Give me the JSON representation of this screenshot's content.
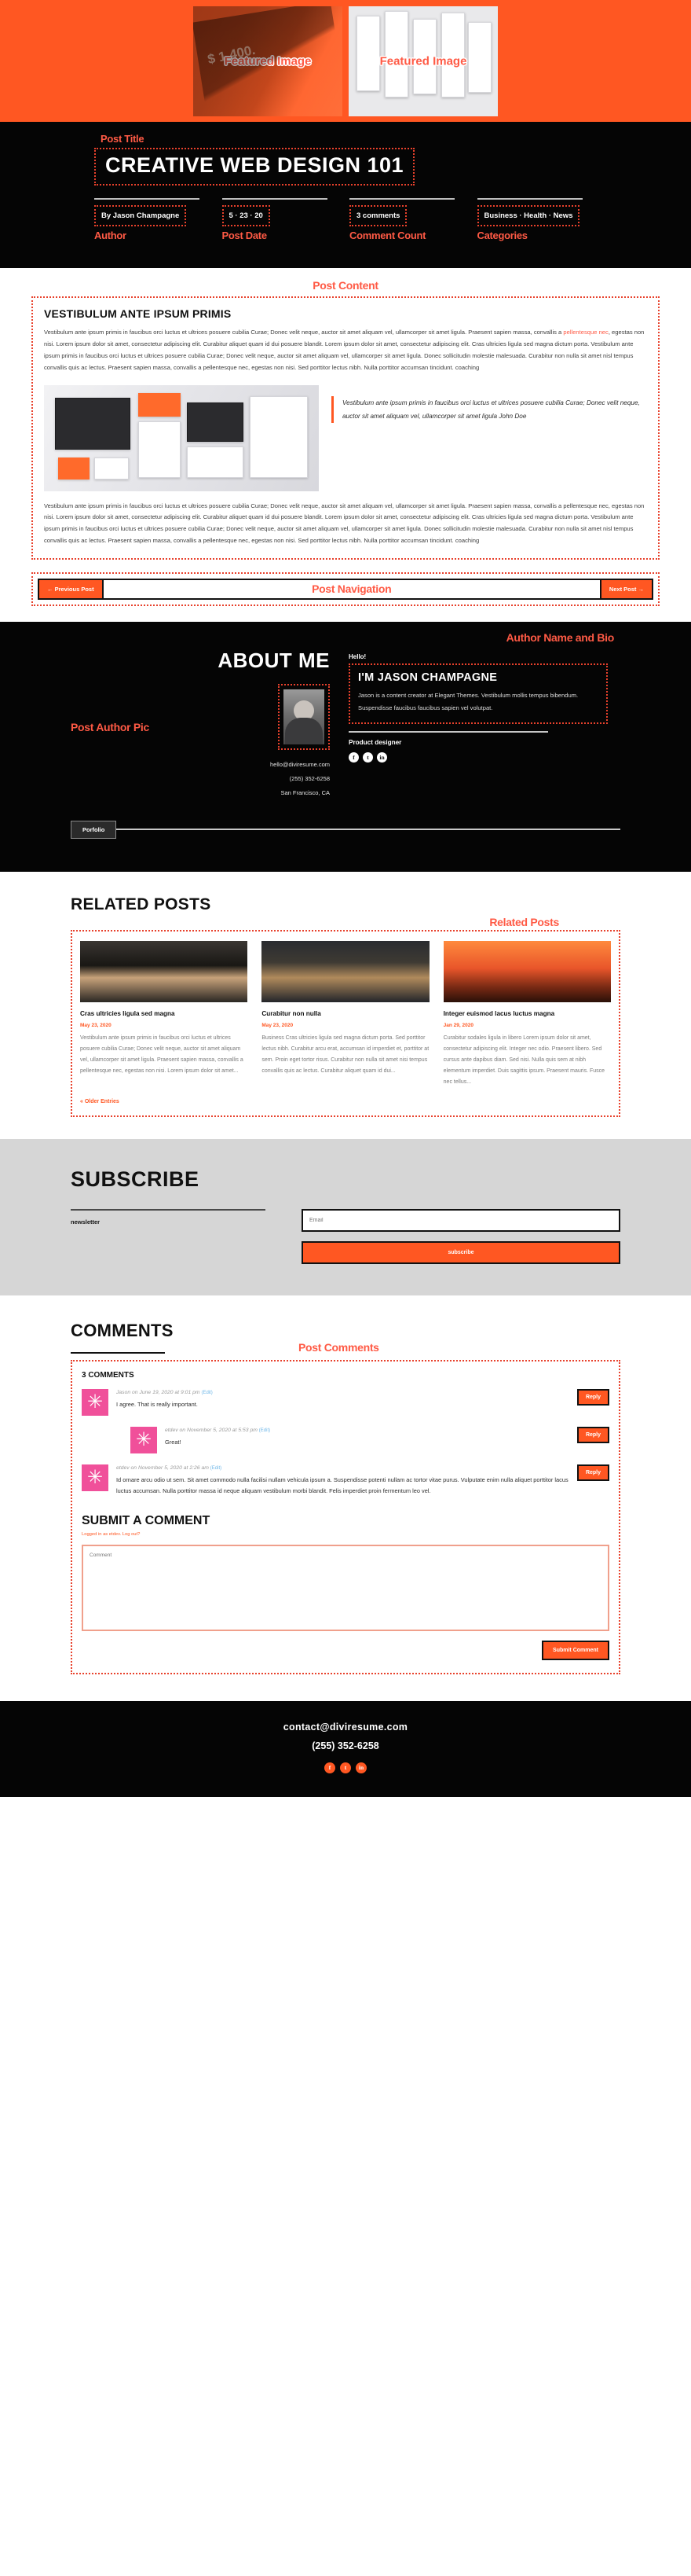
{
  "annotations": {
    "featured_image": "Featured Image",
    "post_title": "Post Title",
    "author": "Author",
    "post_date": "Post Date",
    "comment_count": "Comment Count",
    "categories": "Categories",
    "post_content": "Post Content",
    "post_navigation": "Post Navigation",
    "post_author_pic": "Post Author Pic",
    "author_name_bio": "Author Name and Bio",
    "related_posts": "Related Posts",
    "post_comments": "Post Comments"
  },
  "hero": {
    "left_price_text": "$ 1,400.",
    "label": "Featured Image"
  },
  "header": {
    "title": "CREATIVE WEB DESIGN 101",
    "meta": {
      "author": "By Jason Champagne",
      "date": "5 · 23 · 20",
      "comments": "3 comments",
      "categories": "Business · Health · News"
    }
  },
  "content": {
    "heading": "VESTIBULUM ANTE IPSUM PRIMIS",
    "paragraph1_a": "Vestibulum ante ipsum primis in faucibus orci luctus et ultrices posuere cubilia Curae; Donec velit neque, auctor sit amet aliquam vel, ullamcorper sit amet ligula. Praesent sapien massa, convallis a ",
    "paragraph1_link": "pellentesque nec",
    "paragraph1_b": ", egestas non nisi. Lorem ipsum dolor sit amet, consectetur adipiscing elit. Curabitur aliquet quam id dui posuere blandit. Lorem ipsum dolor sit amet, consectetur adipiscing elit. Cras ultricies ligula sed magna dictum porta. Vestibulum ante ipsum primis in faucibus orci luctus et ultrices posuere cubilia Curae; Donec velit neque, auctor sit amet aliquam vel, ullamcorper sit amet ligula. Donec sollicitudin molestie malesuada. Curabitur non nulla sit amet nisl tempus convallis quis ac lectus. Praesent sapien massa, convallis a pellentesque nec, egestas non nisi. Sed porttitor lectus nibh. Nulla porttitor accumsan tincidunt. coaching",
    "quote": "Vestibulum ante ipsum primis in faucibus orci luctus et ultrices posuere cubilia Curae; Donec velit neque, auctor sit amet aliquam vel, ullamcorper sit amet ligula",
    "quote_author": "John Doe",
    "paragraph2": "Vestibulum ante ipsum primis in faucibus orci luctus et ultrices posuere cubilia Curae; Donec velit neque, auctor sit amet aliquam vel, ullamcorper sit amet ligula. Praesent sapien massa, convallis a pellentesque nec, egestas non nisi. Lorem ipsum dolor sit amet, consectetur adipiscing elit. Curabitur aliquet quam id dui posuere blandit. Lorem ipsum dolor sit amet, consectetur adipiscing elit. Cras ultricies ligula sed magna dictum porta. Vestibulum ante ipsum primis in faucibus orci luctus et ultrices posuere cubilia Curae; Donec velit neque, auctor sit amet aliquam vel, ullamcorper sit amet ligula. Donec sollicitudin molestie malesuada. Curabitur non nulla sit amet nisl tempus convallis quis ac lectus. Praesent sapien massa, convallis a pellentesque nec, egestas non nisi. Sed porttitor lectus nibh. Nulla porttitor accumsan tincidunt. coaching"
  },
  "navigation": {
    "previous": "← Previous Post",
    "next": "Next Post →"
  },
  "about": {
    "title": "ABOUT ME",
    "hello": "Hello!",
    "name": "I'M JASON CHAMPAGNE",
    "bio": "Jason is a content creator at Elegant Themes. Vestibulum mollis tempus bibendum. Suspendisse faucibus faucibus sapien vel volutpat.",
    "job": "Product designer",
    "email": "hello@diviresume.com",
    "phone": "(255) 352-6258",
    "location": "San Francisco, CA",
    "portfolio_button": "Porfolio",
    "socials": [
      "f",
      "t",
      "in"
    ]
  },
  "related": {
    "heading": "RELATED POSTS",
    "older_entries": "« Older Entries",
    "posts": [
      {
        "title": "Cras ultricies ligula sed magna",
        "date": "May 23, 2020",
        "excerpt": "Vestibulum ante ipsum primis in faucibus orci luctus et ultrices posuere cubilia Curae; Donec velit neque, auctor sit amet aliquam vel, ullamcorper sit amet ligula. Praesent sapien massa, convallis a pellentesque nec, egestas non nisi. Lorem ipsum dolor sit amet..."
      },
      {
        "title": "Curabitur non nulla",
        "date": "May 23, 2020",
        "excerpt": "Business Cras ultricies ligula sed magna dictum porta. Sed porttitor lectus nibh. Curabitur arcu erat, accumsan id imperdiet et, porttitor at sem. Proin eget tortor risus. Curabitur non nulla sit amet nisi tempus convallis quis ac lectus. Curabitur aliquet quam id dui..."
      },
      {
        "title": "Integer euismod lacus luctus magna",
        "date": "Jan 29, 2020",
        "excerpt": "Curabitur sodales ligula in libero Lorem ipsum dolor sit amet, consectetur adipiscing elit. Integer nec odio. Praesent libero. Sed cursus ante dapibus diam. Sed nisi. Nulla quis sem at nibh elementum imperdiet. Duis sagittis ipsum. Praesent mauris. Fusce nec tellus..."
      }
    ]
  },
  "subscribe": {
    "heading": "SUBSCRIBE",
    "label": "newsletter",
    "email_placeholder": "Email",
    "button": "subscribe"
  },
  "comments": {
    "heading": "COMMENTS",
    "count_label": "3 COMMENTS",
    "reply_label": "Reply",
    "items": [
      {
        "meta": "Jason on June 19, 2020 at 9:01 pm",
        "edit": "(Edit)",
        "text": "I agree. That is really important.",
        "indent": false
      },
      {
        "meta": "etdev on November 5, 2020 at 5:53 pm",
        "edit": "(Edit)",
        "text": "Great!",
        "indent": true
      },
      {
        "meta": "etdev on November 5, 2020 at 2:26 am",
        "edit": "(Edit)",
        "text": "Id ornare arcu odio ut sem. Sit amet commodo nulla facilisi nullam vehicula ipsum a. Suspendisse potenti nullam ac tortor vitae purus. Vulputate enim nulla aliquet porttitor lacus luctus accumsan. Nulla porttitor massa id neque aliquam vestibulum morbi blandit. Felis imperdiet proin fermentum leo vel.",
        "indent": false
      }
    ],
    "submit_heading": "SUBMIT A COMMENT",
    "submit_note": "Logged in as etdev. Log out?",
    "textarea_placeholder": "Comment",
    "submit_button": "Submit Comment"
  },
  "footer": {
    "email": "contact@diviresume.com",
    "phone": "(255) 352-6258",
    "socials": [
      "f",
      "t",
      "in"
    ]
  },
  "colors": {
    "accent": "#ff5722",
    "annotation": "#ff5a45",
    "dark": "#050505",
    "avatar_pink": "#f0509a"
  }
}
